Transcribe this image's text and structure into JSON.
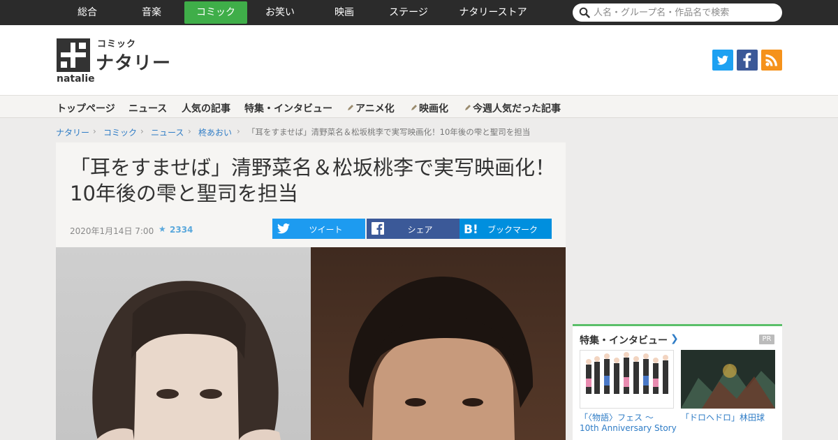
{
  "topnav": {
    "genres": [
      "総合",
      "音楽",
      "コミック",
      "お笑い",
      "映画",
      "ステージ",
      "ナタリーストア"
    ],
    "active_genre": "コミック",
    "search_placeholder": "人名・グループ名・作品名で検索"
  },
  "header": {
    "logo_sub": "コミック",
    "logo_main": "ナタリー",
    "logo_natalie": "natalie",
    "social_icons": [
      "twitter-icon",
      "facebook-icon",
      "rss-icon"
    ],
    "colors": {
      "accent": "#3fae49",
      "twitter": "#1da1f2",
      "facebook": "#3b5998",
      "rss": "#f5921b"
    }
  },
  "subnav": {
    "items": [
      "トップページ",
      "ニュース",
      "人気の記事",
      "特集・インタビュー",
      "アニメ化",
      "映画化",
      "今週人気だった記事"
    ]
  },
  "breadcrumb": {
    "items": [
      "ナタリー",
      "コミック",
      "ニュース",
      "柊あおい"
    ],
    "current": "「耳をすませば」清野菜名＆松坂桃李で実写映画化！10年後の雫と聖司を担当"
  },
  "article": {
    "title": "「耳をすませば」清野菜名＆松坂桃李で実写映画化！10年後の雫と聖司を担当",
    "date": "2020年1月14日 7:00",
    "bookmark_count": "2334",
    "share": {
      "tweet": "ツイート",
      "share": "シェア",
      "bookmark": "ブックマーク"
    }
  },
  "sidebar": {
    "title": "特集・インタビュー",
    "pr_label": "PR",
    "items": [
      {
        "caption_line1": "「〈物語〉フェス ～",
        "caption_line2": "10th Anniversary Story"
      },
      {
        "caption_line1": "「ドロヘドロ」林田球"
      }
    ]
  }
}
